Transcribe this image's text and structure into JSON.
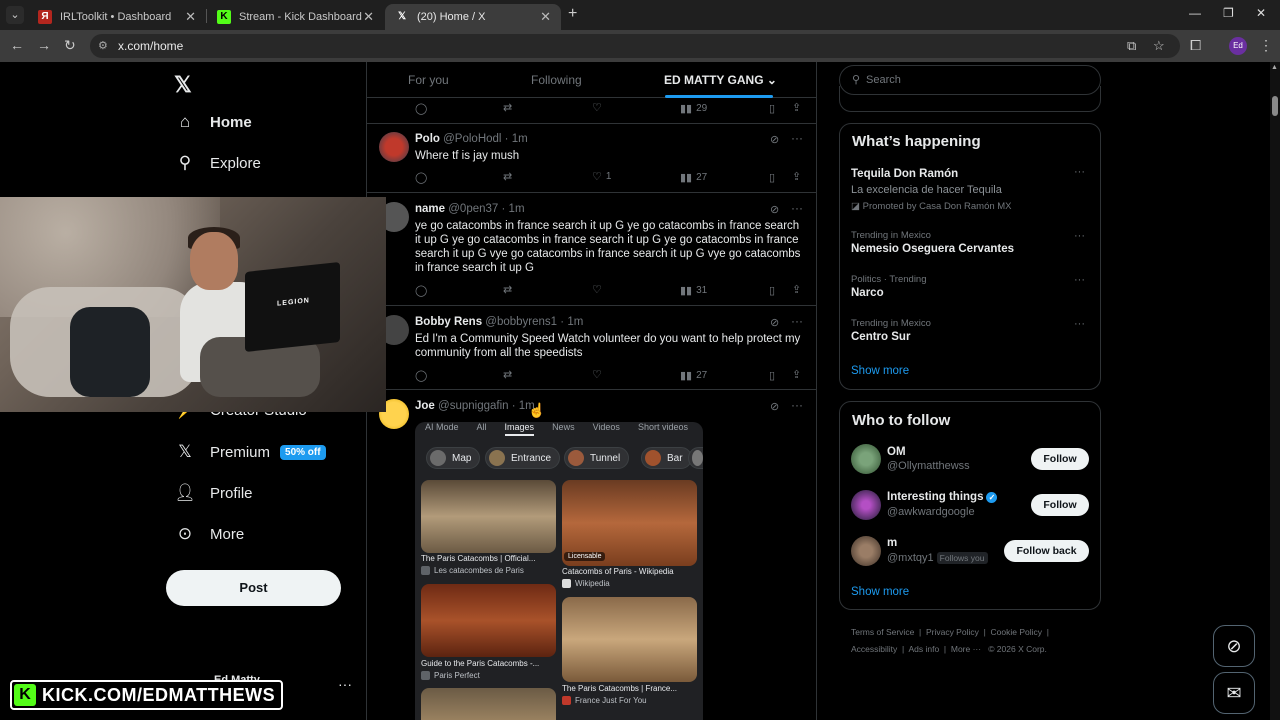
{
  "browser": {
    "tabs": [
      {
        "title": "IRLToolkit • Dashboard"
      },
      {
        "title": "Stream - Kick Dashboard"
      },
      {
        "title": "(20) Home / X"
      }
    ],
    "url": "x.com/home",
    "profile_initials": "Ed"
  },
  "nav": {
    "home": "Home",
    "explore": "Explore",
    "creator_studio": "Creator Studio",
    "premium": "Premium",
    "premium_badge": "50% off",
    "profile": "Profile",
    "more": "More",
    "post": "Post",
    "account_name": "Ed Matty"
  },
  "overlay": {
    "kick_url": "KICK.COM/EDMATTHEWS",
    "laptop_brand": "LEGION"
  },
  "feed": {
    "tabs": [
      "For you",
      "Following",
      "ED MATTY GANG"
    ],
    "top_views": "29",
    "tweets": [
      {
        "name": "Polo",
        "handle": "@PoloHodl",
        "time": "1m",
        "text": "Where tf is jay mush",
        "likes": "1",
        "views": "27"
      },
      {
        "name": "name",
        "handle": "@0pen37",
        "time": "1m",
        "text": "ye go catacombs in france search it up G ye go catacombs in france search it up G ye go catacombs in france search it up G ye go catacombs in france search it up G vye go catacombs in france search it up G vye go catacombs in france search it up G",
        "views": "31"
      },
      {
        "name": "Bobby Rens",
        "handle": "@bobbyrens1",
        "time": "1m",
        "text": "Ed I'm a Community Speed Watch volunteer do you want to help protect my community from all the speedists",
        "views": "27"
      },
      {
        "name": "Joe",
        "handle": "@supniggafin",
        "time": "1m"
      }
    ],
    "image_result": {
      "search_tabs": [
        "AI Mode",
        "All",
        "Images",
        "News",
        "Videos",
        "Short videos"
      ],
      "chips": [
        "Map",
        "Entrance",
        "Tunnel",
        "Bar"
      ],
      "results": [
        {
          "caption": "The Paris Catacombs | Official...",
          "source": "Les catacombes de Paris"
        },
        {
          "caption": "Catacombs of Paris - Wikipedia",
          "source": "Wikipedia",
          "badge": "Licensable"
        },
        {
          "caption": "Guide to the Paris Catacombs -...",
          "source": "Paris Perfect"
        },
        {
          "caption": "The Paris Catacombs | France...",
          "source": "France Just For You"
        }
      ]
    }
  },
  "sidebar": {
    "search_placeholder": "Search",
    "whats_happening": "What’s happening",
    "trends": [
      {
        "meta": "",
        "name": "Tequila Don Ramón",
        "sub": "La excelencia de hacer Tequila",
        "promo": "Promoted by Casa Don Ramón MX"
      },
      {
        "meta": "Trending in Mexico",
        "name": "Nemesio Oseguera Cervantes"
      },
      {
        "meta": "Politics · Trending",
        "name": "Narco"
      },
      {
        "meta": "Trending in Mexico",
        "name": "Centro Sur"
      }
    ],
    "show_more": "Show more",
    "who_to_follow": "Who to follow",
    "suggestions": [
      {
        "name": "OM",
        "handle": "@Ollymatthewss",
        "button": "Follow"
      },
      {
        "name": "Interesting things",
        "handle": "@awkwardgoogle",
        "button": "Follow"
      },
      {
        "name": "m",
        "handle": "@mxtqy1",
        "follows_you": "Follows you",
        "button": "Follow back"
      }
    ],
    "footer": {
      "line1": [
        "Terms of Service",
        "Privacy Policy",
        "Cookie Policy"
      ],
      "line2": [
        "Accessibility",
        "Ads info",
        "More ···",
        "© 2026 X Corp."
      ]
    }
  }
}
